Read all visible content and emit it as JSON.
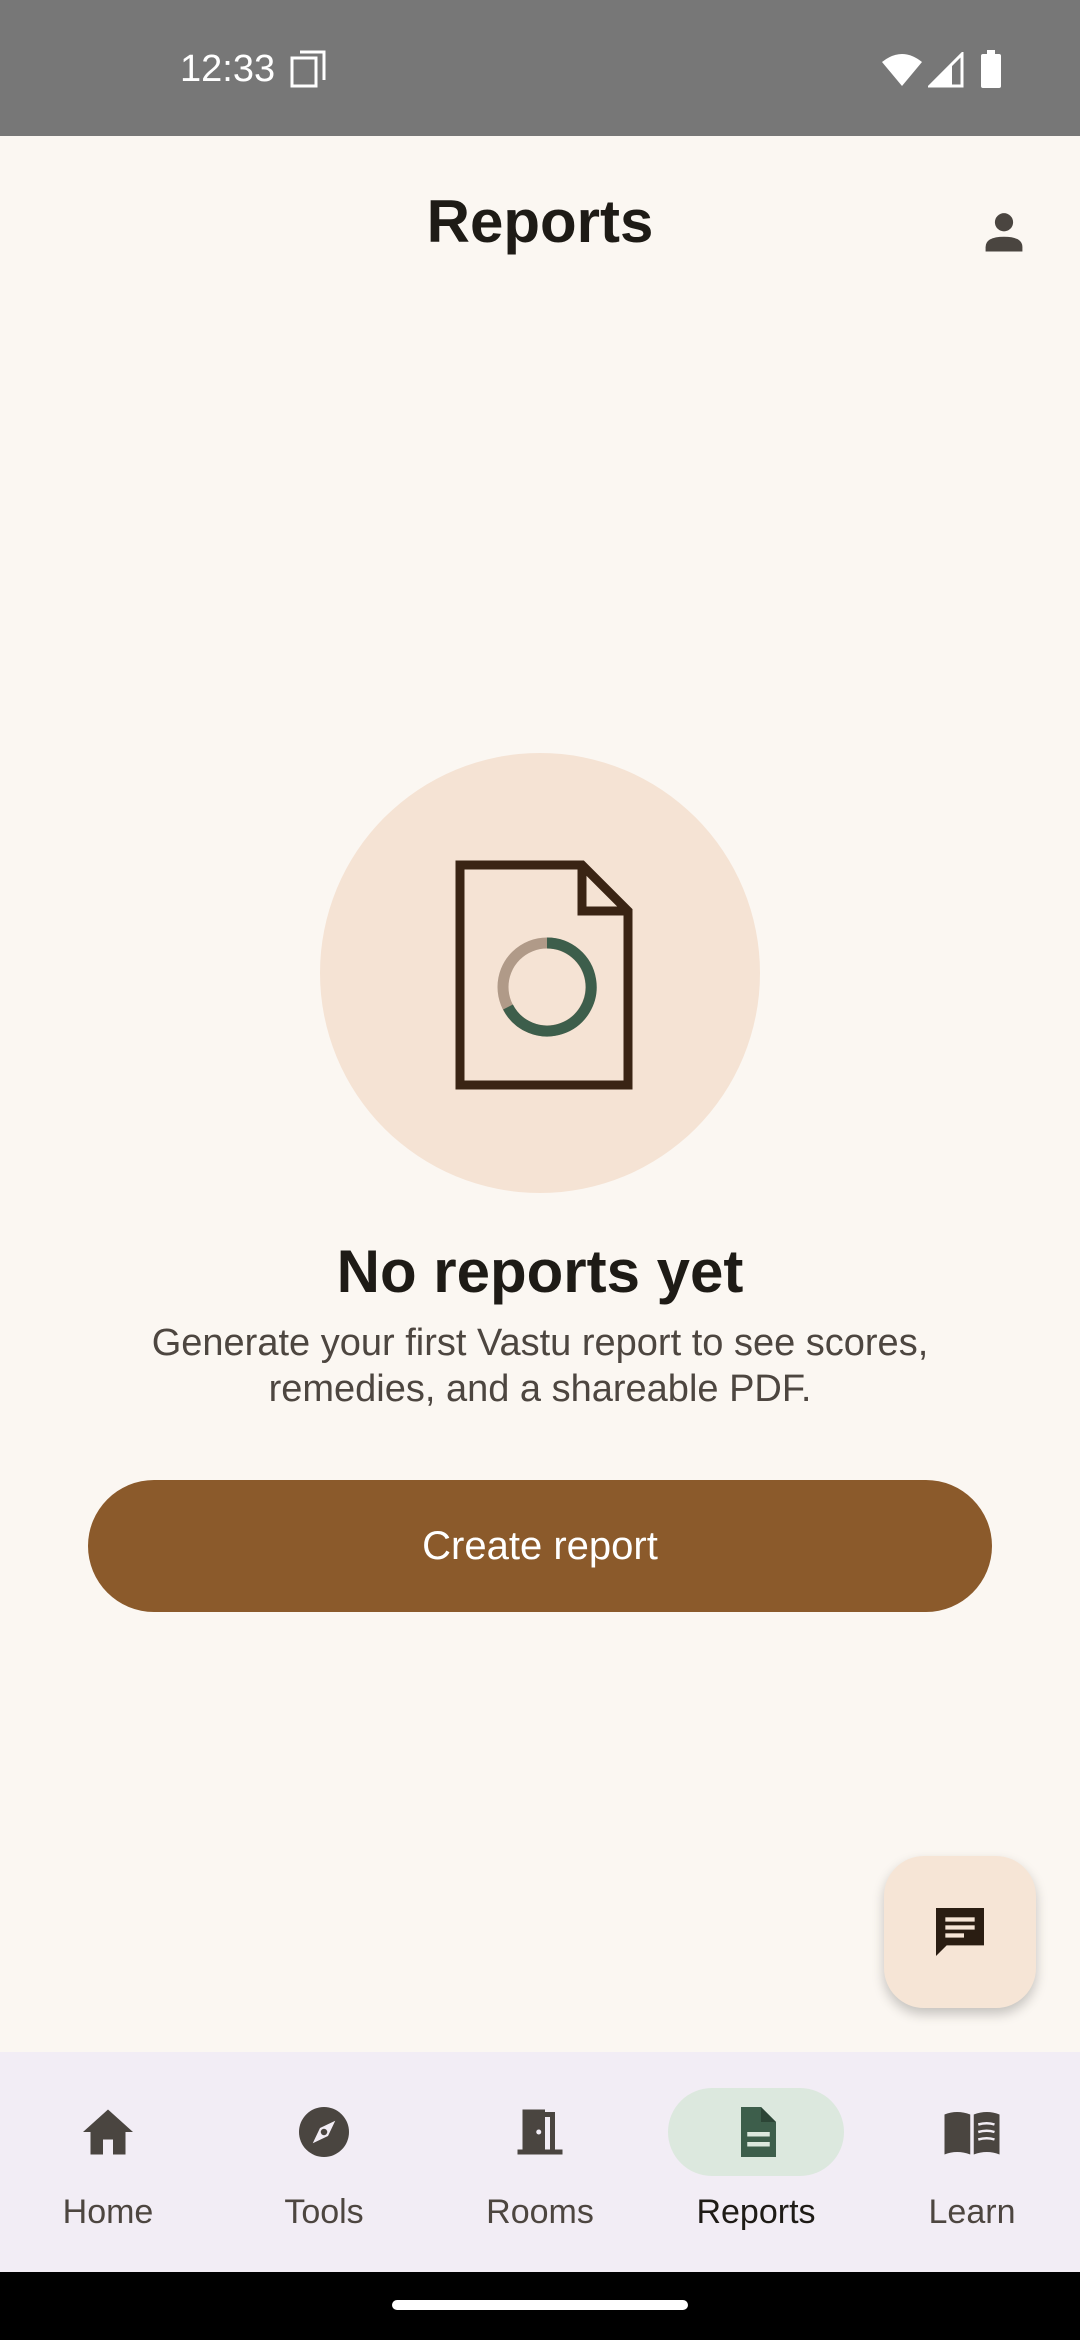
{
  "status_bar": {
    "time": "12:33",
    "icons": [
      "screenshot-icon",
      "wifi-icon",
      "signal-icon",
      "battery-icon"
    ]
  },
  "app_bar": {
    "title": "Reports",
    "profile_icon": "person-icon"
  },
  "empty_state": {
    "illustration_icon": "document-donut-icon",
    "title": "No reports yet",
    "subtitle": "Generate your first Vastu report to see scores, remedies, and a shareable PDF.",
    "button_label": "Create report"
  },
  "fab": {
    "icon": "chat-icon"
  },
  "bottom_nav": {
    "items": [
      {
        "label": "Home",
        "icon": "home-icon",
        "active": false
      },
      {
        "label": "Tools",
        "icon": "compass-icon",
        "active": false
      },
      {
        "label": "Rooms",
        "icon": "door-icon",
        "active": false
      },
      {
        "label": "Reports",
        "icon": "document-icon",
        "active": true
      },
      {
        "label": "Learn",
        "icon": "book-icon",
        "active": false
      }
    ]
  },
  "colors": {
    "background": "#FBF7F2",
    "primary_brown": "#8B5A2B",
    "illustration_bg": "#F5E3D4",
    "accent_green": "#3D5E4B",
    "nav_background": "#F2EDF5",
    "nav_active_pill": "#DCE8DE",
    "status_bar": "#777777"
  }
}
